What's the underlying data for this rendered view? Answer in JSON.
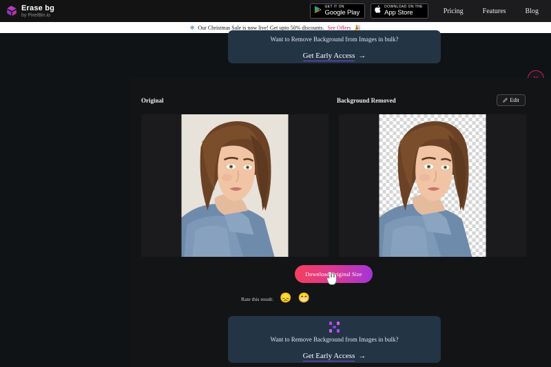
{
  "header": {
    "logo": {
      "title": "Erase bg",
      "subtitle": "by PixelBin.io",
      "icon": "erasebg-logo-icon"
    },
    "google_play": {
      "small": "GET IT ON",
      "big": "Google Play",
      "icon": "google-play-icon"
    },
    "app_store": {
      "small": "Download on the",
      "big": "App Store",
      "icon": "apple-icon"
    },
    "nav": [
      {
        "label": "Pricing"
      },
      {
        "label": "Features"
      },
      {
        "label": "Blog"
      }
    ]
  },
  "sale_banner": {
    "snow_icon": "snowflake-icon",
    "text": "Our Christmas Sale is now live! Get upto 50% discounts.",
    "link": "See Offers",
    "tada_icon": "party-popper-icon"
  },
  "cta": {
    "text": "Want to Remove Background from Images in bulk?",
    "link": "Get Early Access",
    "arrow": "→",
    "icon": "pixelbin-x-icon"
  },
  "modal": {
    "close_icon": "close-icon",
    "original_label": "Original",
    "removed_label": "Background Removed",
    "edit_button": "Edit",
    "edit_icon": "pencil-icon"
  },
  "actions": {
    "download_label": "Download Original Size",
    "cursor": "pointer-hand-cursor"
  },
  "rating": {
    "label": "Rate this result:",
    "options": [
      {
        "name": "sad-emoji",
        "glyph": "😞"
      },
      {
        "name": "happy-emoji",
        "glyph": "😁"
      }
    ]
  },
  "colors": {
    "accent_pink": "#e91e63",
    "accent_purple": "#7d4ae0",
    "cta_panel": "#233445",
    "page_bg": "#0f1315"
  }
}
